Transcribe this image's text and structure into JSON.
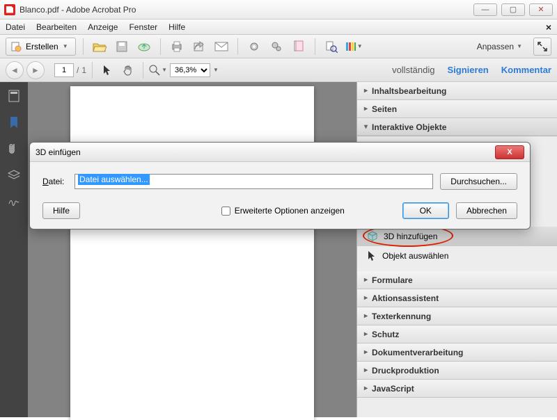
{
  "window": {
    "title": "Blanco.pdf - Adobe Acrobat Pro"
  },
  "menu": {
    "items": [
      "Datei",
      "Bearbeiten",
      "Anzeige",
      "Fenster",
      "Hilfe"
    ]
  },
  "toolbar": {
    "create": "Erstellen",
    "customize": "Anpassen"
  },
  "nav": {
    "page": "1",
    "total": "1",
    "zoom": "36,3%",
    "voll": "vollständig",
    "sign": "Signieren",
    "comment": "Kommentar"
  },
  "panels": {
    "p0": "Inhaltsbearbeitung",
    "p1": "Seiten",
    "p2": "Interaktive Objekte",
    "sub0": "3D hinzufügen",
    "sub1": "Objekt auswählen",
    "p3": "Formulare",
    "p4": "Aktionsassistent",
    "p5": "Texterkennung",
    "p6": "Schutz",
    "p7": "Dokumentverarbeitung",
    "p8": "Druckproduktion",
    "p9": "JavaScript"
  },
  "dialog": {
    "title": "3D einfügen",
    "file_label": "Datei:",
    "file_value": "Datei auswählen...",
    "browse": "Durchsuchen...",
    "help": "Hilfe",
    "extended": "Erweiterte Optionen anzeigen",
    "ok": "OK",
    "cancel": "Abbrechen"
  }
}
